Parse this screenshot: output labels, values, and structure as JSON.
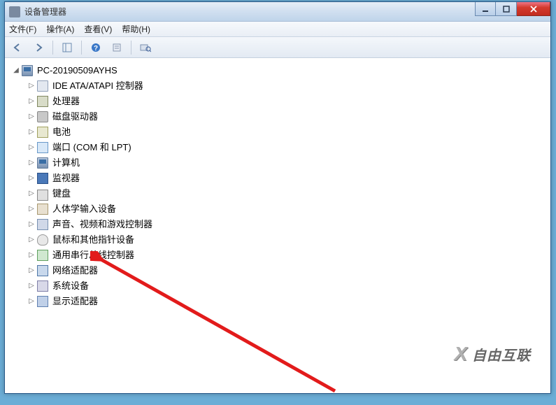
{
  "window": {
    "title": "设备管理器"
  },
  "menubar": {
    "file": "文件(F)",
    "action": "操作(A)",
    "view": "查看(V)",
    "help": "帮助(H)"
  },
  "tree": {
    "root": "PC-20190509AYHS",
    "items": [
      "IDE ATA/ATAPI 控制器",
      "处理器",
      "磁盘驱动器",
      "电池",
      "端口 (COM 和 LPT)",
      "计算机",
      "监视器",
      "键盘",
      "人体学输入设备",
      "声音、视频和游戏控制器",
      "鼠标和其他指针设备",
      "通用串行总线控制器",
      "网络适配器",
      "系统设备",
      "显示适配器"
    ]
  },
  "watermark": "自由互联"
}
